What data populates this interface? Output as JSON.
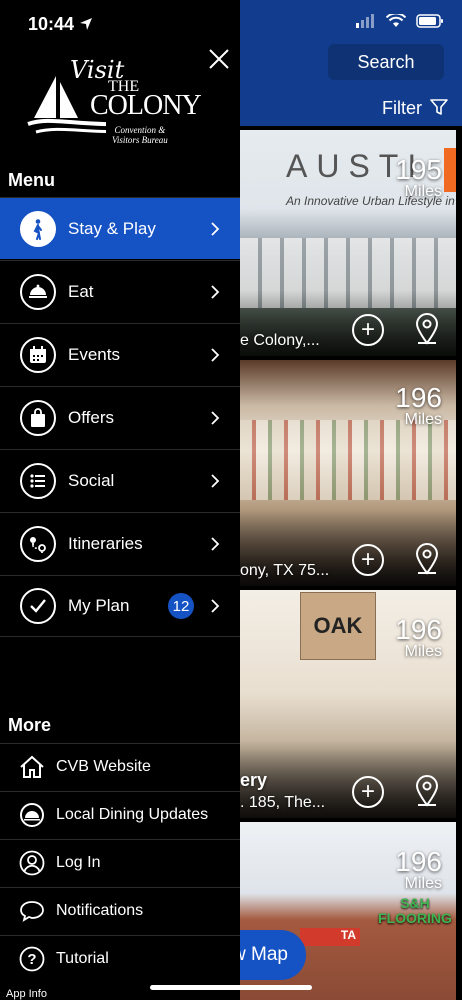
{
  "status": {
    "time": "10:44"
  },
  "header": {
    "search_label": "Search",
    "filter_label": "Filter"
  },
  "cards": [
    {
      "distance": "195",
      "unit": "Miles",
      "caption": "e Colony,...",
      "banner_text": "AUSTI",
      "banner_sub": "An Innovative Urban Lifestyle in"
    },
    {
      "distance": "196",
      "unit": "Miles",
      "caption": "ony, TX 75..."
    },
    {
      "distance": "196",
      "unit": "Miles",
      "caption_line1": "ery",
      "caption": ". 185, The...",
      "sign_text": "OAK"
    },
    {
      "distance": "196",
      "unit": "Miles",
      "sign_text": "S&H FLOORING",
      "sign_text2": "TA"
    }
  ],
  "map_button": {
    "label": "w Map"
  },
  "drawer": {
    "logo_line1": "Visit",
    "logo_line2": "THE",
    "logo_line3": "COLONY",
    "logo_line4": "Convention &",
    "logo_line5": "Visitors Bureau",
    "menu_title": "Menu",
    "menu": [
      {
        "label": "Stay & Play",
        "icon": "walking-person-icon"
      },
      {
        "label": "Eat",
        "icon": "food-tray-icon"
      },
      {
        "label": "Events",
        "icon": "calendar-icon"
      },
      {
        "label": "Offers",
        "icon": "shopping-bag-icon"
      },
      {
        "label": "Social",
        "icon": "list-icon"
      },
      {
        "label": "Itineraries",
        "icon": "route-icon"
      },
      {
        "label": "My Plan",
        "icon": "checkmark-icon",
        "badge": "12"
      }
    ],
    "more_title": "More",
    "more": [
      {
        "label": "CVB Website",
        "icon": "home-icon"
      },
      {
        "label": "Local Dining Updates",
        "icon": "food-tray-icon"
      },
      {
        "label": "Log In",
        "icon": "user-icon"
      },
      {
        "label": "Notifications",
        "icon": "speech-bubble-icon"
      },
      {
        "label": "Tutorial",
        "icon": "question-icon"
      }
    ],
    "app_info": "App Info"
  },
  "colors": {
    "brand_blue": "#123d8e",
    "active_blue": "#1552c3"
  }
}
